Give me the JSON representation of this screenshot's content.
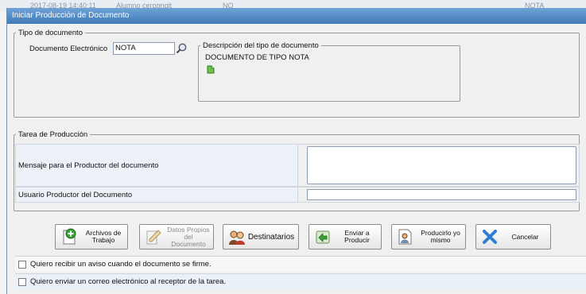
{
  "background_row": {
    "date": "2017-08-19 14:40:11",
    "user": "Alumno cerogngit",
    "code": "NO",
    "type": "NOTA"
  },
  "window": {
    "title": "Iniciar Producción de Documento"
  },
  "tipo_documento": {
    "legend": "Tipo de documento",
    "field_label": "Documento Electrónico",
    "field_value": "NOTA",
    "descripcion": {
      "legend": "Descripción del tipo de documento",
      "text": "DOCUMENTO DE TIPO NOTA"
    }
  },
  "tarea": {
    "legend": "Tarea de Producción",
    "mensaje_label": "Mensaje para el Productor del documento",
    "mensaje_value": "",
    "usuario_label": "Usuario Productor del Documento",
    "usuario_value": ""
  },
  "buttons": {
    "archivos": "Archivos de Trabajo",
    "datos": "Datos Propios del Documento",
    "destinatarios": "Destinatarios",
    "enviar": "Enviar a Producir",
    "producirlo": "Producirlo yo mismo",
    "cancelar": "Cancelar"
  },
  "checkboxes": {
    "aviso": "Quiero recibir un aviso cuando el documento se firme.",
    "correo": "Quiero enviar un correo electrónico al receptor de la tarea."
  },
  "colors": {
    "titlebar": "#4f88c6",
    "accent": "#3f7ab8"
  }
}
